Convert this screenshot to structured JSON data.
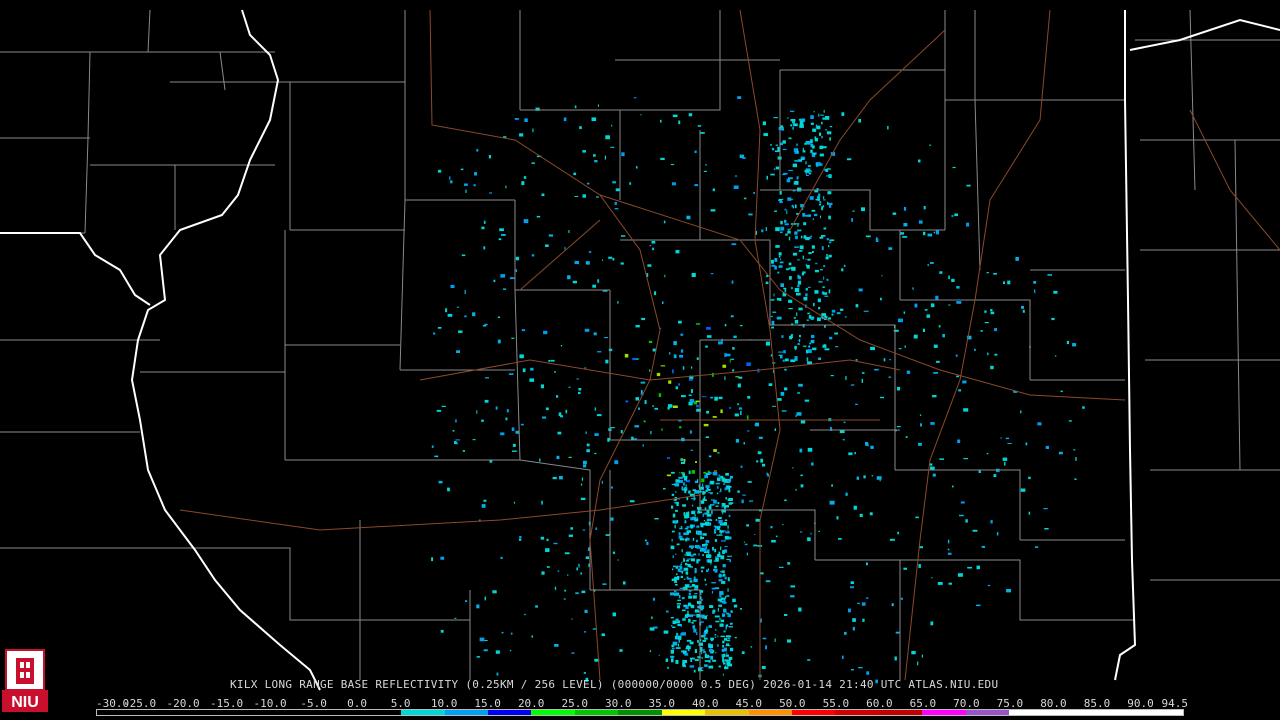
{
  "product": {
    "title": "KILX LONG RANGE BASE REFLECTIVITY (0.25KM / 256 LEVEL) (000000/0000 0.5 DEG) 2026-01-14 21:40 UTC  ATLAS.NIU.EDU",
    "station": "KILX",
    "source": "ATLAS.NIU.EDU",
    "timestamp": "2026-01-14 21:40 UTC"
  },
  "logo": {
    "text": "NIU",
    "color": "#c8102e"
  },
  "color_scale": {
    "labels": [
      "-30.0",
      "-25.0",
      "-20.0",
      "-15.0",
      "-10.0",
      "-5.0",
      "0.0",
      "5.0",
      "10.0",
      "15.0",
      "20.0",
      "25.0",
      "30.0",
      "35.0",
      "40.0",
      "45.0",
      "50.0",
      "55.0",
      "60.0",
      "65.0",
      "70.0",
      "75.0",
      "80.0",
      "85.0",
      "90.0",
      "94.5"
    ],
    "colors": [
      "#000000",
      "#000000",
      "#000000",
      "#000000",
      "#000000",
      "#000000",
      "#000000",
      "#00d8d8",
      "#00a0f0",
      "#0000f0",
      "#00ff00",
      "#00c800",
      "#009000",
      "#ffff00",
      "#e8c000",
      "#ff9000",
      "#ff0000",
      "#d00000",
      "#c00000",
      "#ff00ff",
      "#9955c8",
      "#ffffff",
      "#ffffff",
      "#ffffff",
      "#ffffff"
    ]
  },
  "map_colors": {
    "county_lines": "#8a8a8a",
    "state_lines": "#ffffff",
    "highways": "#8b4a2a"
  }
}
